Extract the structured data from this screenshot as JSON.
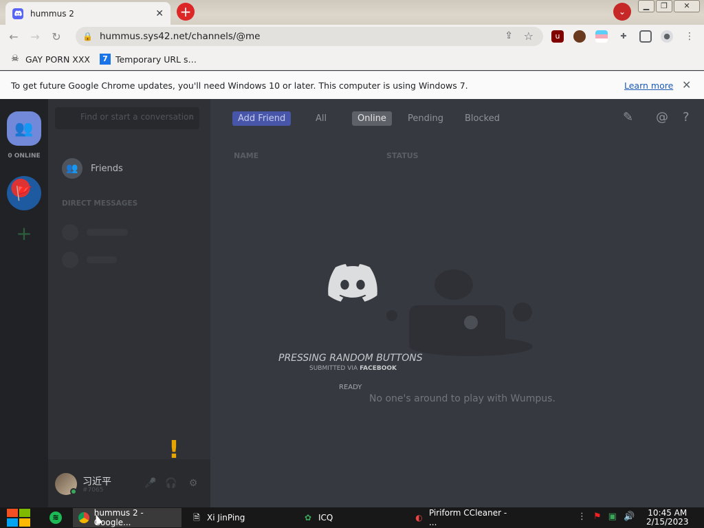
{
  "browser": {
    "tab_title": "hummus 2",
    "url": "hummus.sys42.net/channels/@me",
    "bookmarks": [
      {
        "label": "GAY PORN XXX"
      },
      {
        "label": "Temporary URL s…"
      }
    ],
    "info_message": "To get future Google Chrome updates, you'll need Windows 10 or later. This computer is using Windows 7.",
    "info_link": "Learn more"
  },
  "discord": {
    "online_count": "0 ONLINE",
    "search_placeholder": "Find or start a conversation",
    "friends_label": "Friends",
    "dm_header": "DIRECT MESSAGES",
    "tabs": {
      "add_friend": "Add Friend",
      "all": "All",
      "online": "Online",
      "pending": "Pending",
      "blocked": "Blocked"
    },
    "columns": {
      "name": "NAME",
      "status": "STATUS"
    },
    "empty_message": "No one's around to play with Wumpus.",
    "user": {
      "name": "习近平",
      "tag": "#7065"
    },
    "overlay": {
      "title": "PRESSING RANDOM BUTTONS",
      "submitted_via": "SUBMITTED VIA",
      "source": "FACEBOOK",
      "status": "READY"
    }
  },
  "taskbar": {
    "tasks": [
      {
        "label": "hummus 2 - Google..."
      },
      {
        "label": "Xi JinPing"
      },
      {
        "label": "ICQ"
      },
      {
        "label": "Piriform CCleaner - ..."
      }
    ],
    "time": "10:45 AM",
    "date": "2/15/2023"
  },
  "colors": {
    "blurple": "#7289da",
    "discord_bg": "#36393f",
    "online_green": "#3ba55c"
  }
}
